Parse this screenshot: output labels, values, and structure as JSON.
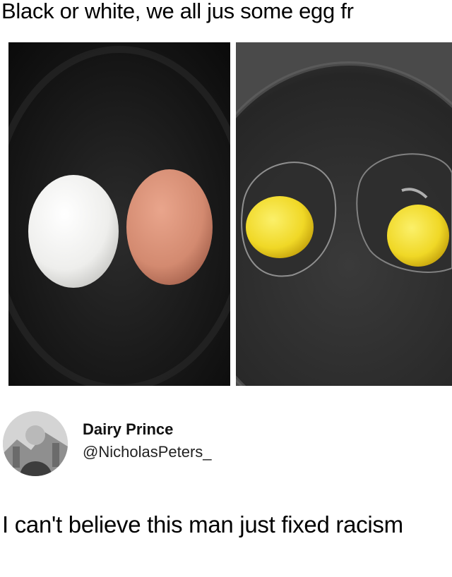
{
  "meme": {
    "caption": "Black or white, we all jus some egg fr"
  },
  "photos": {
    "left": {
      "subject": "white-egg-and-brown-egg"
    },
    "right": {
      "subject": "two-fried-eggs-in-pan"
    }
  },
  "tweet": {
    "display_name": "Dairy Prince",
    "handle": "@NicholasPeters_",
    "text": "I can't believe this man just fixed racism"
  },
  "colors": {
    "pan_dark": "#1a1a1a",
    "white_egg": "#f4f4f2",
    "brown_egg": "#d8907a",
    "yolk": "#f1dc2a"
  }
}
